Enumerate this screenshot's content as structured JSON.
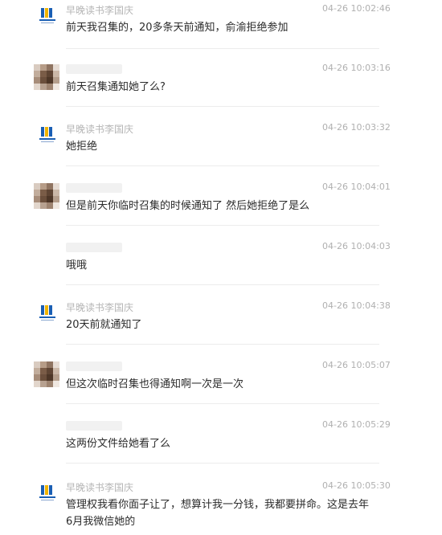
{
  "messages": [
    {
      "sender": "早晚读书李国庆",
      "time": "04-26 10:02:46",
      "text": "前天我召集的，20多条天前通知，俞渝拒绝参加",
      "avatar": "logo"
    },
    {
      "sender": "",
      "time": "04-26 10:03:16",
      "text": "前天召集通知她了么?",
      "avatar": "pixelated"
    },
    {
      "sender": "早晚读书李国庆",
      "time": "04-26 10:03:32",
      "text": "她拒绝",
      "avatar": "logo"
    },
    {
      "sender": "",
      "time": "04-26 10:04:01",
      "text": "但是前天你临时召集的时候通知了 然后她拒绝了是么",
      "avatar": "pixelated"
    },
    {
      "sender": "",
      "time": "04-26 10:04:03",
      "text": "哦哦",
      "avatar": "blank"
    },
    {
      "sender": "早晚读书李国庆",
      "time": "04-26 10:04:38",
      "text": "20天前就通知了",
      "avatar": "logo"
    },
    {
      "sender": "",
      "time": "04-26 10:05:07",
      "text": "但这次临时召集也得通知啊一次是一次",
      "avatar": "pixelated"
    },
    {
      "sender": "",
      "time": "04-26 10:05:29",
      "text": "这两份文件给她看了么",
      "avatar": "blank"
    },
    {
      "sender": "早晚读书李国庆",
      "time": "04-26 10:05:30",
      "text": "管理权我看你面子让了，想算计我一分钱，我都要拼命。这是去年6月我微信她的",
      "avatar": "logo"
    }
  ],
  "colors": {
    "sender": "#b5b5b5",
    "time": "#b0b0b0",
    "text": "#2b2b2b",
    "logo_blue": "#1a5fb4",
    "logo_yellow": "#f0b400"
  }
}
